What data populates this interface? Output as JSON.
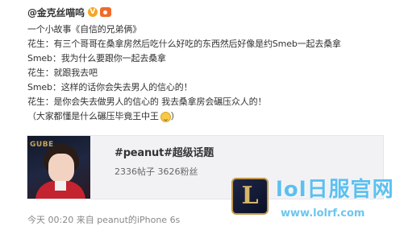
{
  "post": {
    "username": "@金克丝喵呜",
    "badges": {
      "verified": "V",
      "member_icon": "member-crown-icon"
    },
    "lines": [
      "一个小故事《自信的兄弟俩》",
      "花生：有三个哥哥在桑拿房然后吃什么好吃的东西然后好像是约Smeb一起去桑拿",
      "Smeb：我为什么要跟你一起去桑拿",
      "花生：就跟我去吧",
      "Smeb：这样的话你会失去男人的信心的！",
      "花生：是你会失去做男人的信心的 我去桑拿房会碾压众人的！"
    ],
    "last_line": "（大家都懂是什么碾压毕竟王中王",
    "last_line_close": "）",
    "last_line_emoji": "laugh-cry-emoji-icon",
    "card": {
      "title": "#peanut#超级话题",
      "stats": "2336帖子 3626粉丝",
      "thumb_text": "GUBE"
    },
    "footer": "今天 00:20 来自 peanut的iPhone 6s"
  },
  "watermark": {
    "logo_letter": "L",
    "title": "lol日服官网",
    "url": "www.lolrf.com"
  },
  "colors": {
    "text": "#333333",
    "meta": "#888888",
    "card_bg": "#f2f2f5",
    "verified": "#f5a623",
    "watermark": "#5cc0f0"
  }
}
